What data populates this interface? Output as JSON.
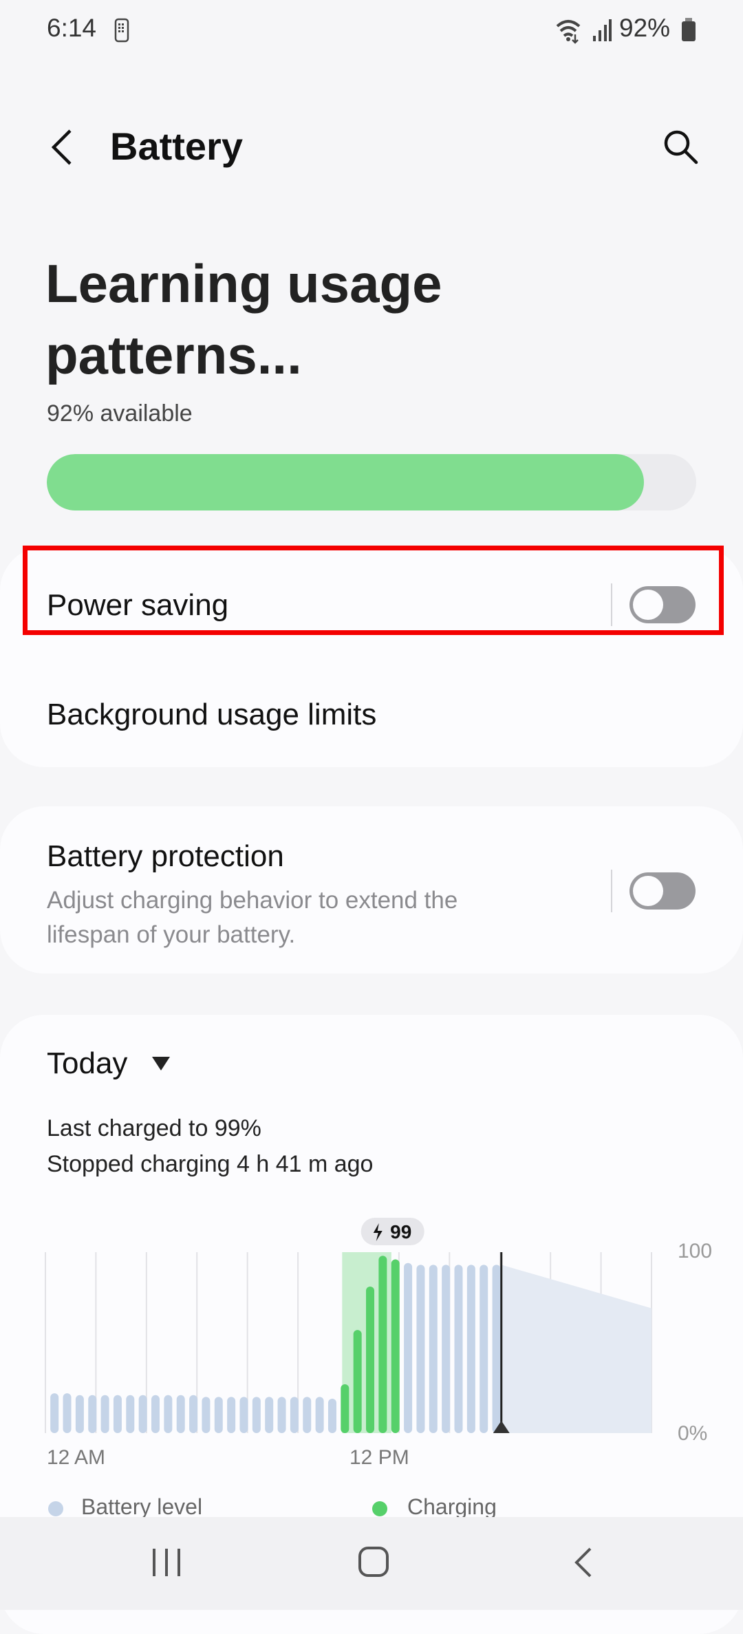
{
  "status_bar": {
    "time": "6:14",
    "battery": "92%",
    "icons": [
      "sim-icon",
      "wifi-icon",
      "signal-icon",
      "battery-icon"
    ]
  },
  "header": {
    "title": "Battery",
    "back_icon": "back-arrow-icon",
    "search_icon": "search-icon"
  },
  "summary": {
    "title_line1": "Learning usage",
    "title_line2": "patterns...",
    "available": "92% available",
    "level_percent": 92,
    "bar_color": "#80dd8f"
  },
  "settings": {
    "power_saving": {
      "label": "Power saving",
      "enabled": false
    },
    "background_limits": {
      "label": "Background usage limits"
    },
    "battery_protection": {
      "label": "Battery protection",
      "description_line1": "Adjust charging behavior to extend the",
      "description_line2": "lifespan of your battery.",
      "enabled": false
    }
  },
  "usage": {
    "period": "Today",
    "last_charged": "Last charged to 99%",
    "stopped_charging": "Stopped charging 4 h 41 m ago"
  },
  "chart_data": {
    "type": "bar",
    "x_tick_labels": [
      "12 AM",
      "12 PM"
    ],
    "y_tick_labels": [
      "100",
      "0%"
    ],
    "ylim": [
      0,
      100
    ],
    "bar_interval": "30 min",
    "values": [
      22,
      22,
      21,
      21,
      21,
      21,
      21,
      21,
      21,
      21,
      21,
      21,
      20,
      20,
      20,
      20,
      20,
      20,
      20,
      20,
      20,
      20,
      19,
      27,
      57,
      81,
      98,
      96,
      94,
      93,
      93,
      93,
      93,
      93,
      93,
      93
    ],
    "charging": [
      false,
      false,
      false,
      false,
      false,
      false,
      false,
      false,
      false,
      false,
      false,
      false,
      false,
      false,
      false,
      false,
      false,
      false,
      false,
      false,
      false,
      false,
      false,
      true,
      true,
      true,
      true,
      true,
      false,
      false,
      false,
      false,
      false,
      false,
      false,
      false
    ],
    "prediction": {
      "start": 93,
      "end": 69
    },
    "charge_badge": "99",
    "colors": {
      "battery": "#c5d4e8",
      "charging": "#56d06a",
      "charging_zone": "#c8eecf",
      "prediction": "#e4eaf3"
    },
    "legend": [
      {
        "label": "Battery level",
        "color": "#c5d4e8"
      },
      {
        "label": "Charging",
        "color": "#56d06a"
      }
    ],
    "legend_placement": "bottom",
    "grid": true
  },
  "nav": {
    "recents_icon": "recents-icon",
    "home_icon": "home-icon",
    "back_icon": "back-icon"
  }
}
